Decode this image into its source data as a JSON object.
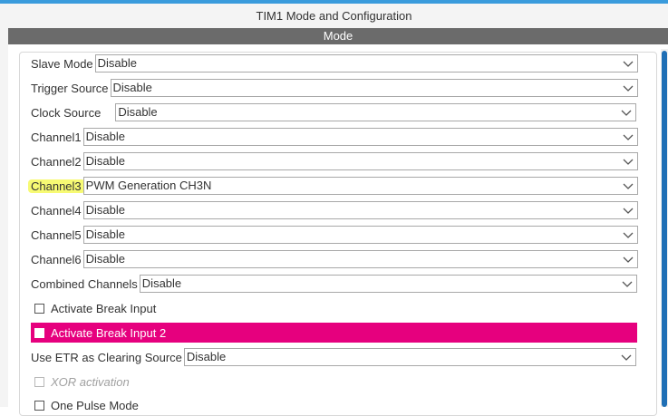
{
  "window": {
    "title": "TIM1 Mode and Configuration"
  },
  "section": {
    "title": "Mode"
  },
  "fields": [
    {
      "label": "Slave Mode",
      "value": "Disable"
    },
    {
      "label": "Trigger Source",
      "value": "Disable"
    },
    {
      "label": "Clock Source",
      "value": "Disable"
    },
    {
      "label": "Channel1",
      "value": "Disable"
    },
    {
      "label": "Channel2",
      "value": "Disable"
    },
    {
      "label": "Channel3",
      "value": "PWM Generation CH3N"
    },
    {
      "label": "Channel4",
      "value": "Disable"
    },
    {
      "label": "Channel5",
      "value": "Disable"
    },
    {
      "label": "Channel6",
      "value": "Disable"
    },
    {
      "label": "Combined Channels",
      "value": "Disable"
    }
  ],
  "checks": {
    "break_input": {
      "label": "Activate Break Input",
      "checked": false
    },
    "break_input_2": {
      "label": "Activate Break Input 2",
      "checked": false
    },
    "xor_activation": {
      "label": "XOR activation",
      "checked": false
    },
    "one_pulse": {
      "label": "One Pulse Mode",
      "checked": false
    }
  },
  "etr": {
    "label": "Use ETR as Clearing Source",
    "value": "Disable"
  },
  "colors": {
    "accent": "#3a9bdc",
    "highlight": "#e6007e",
    "marker": "#f6f95a",
    "scrollbar": "#1f6fb5"
  }
}
